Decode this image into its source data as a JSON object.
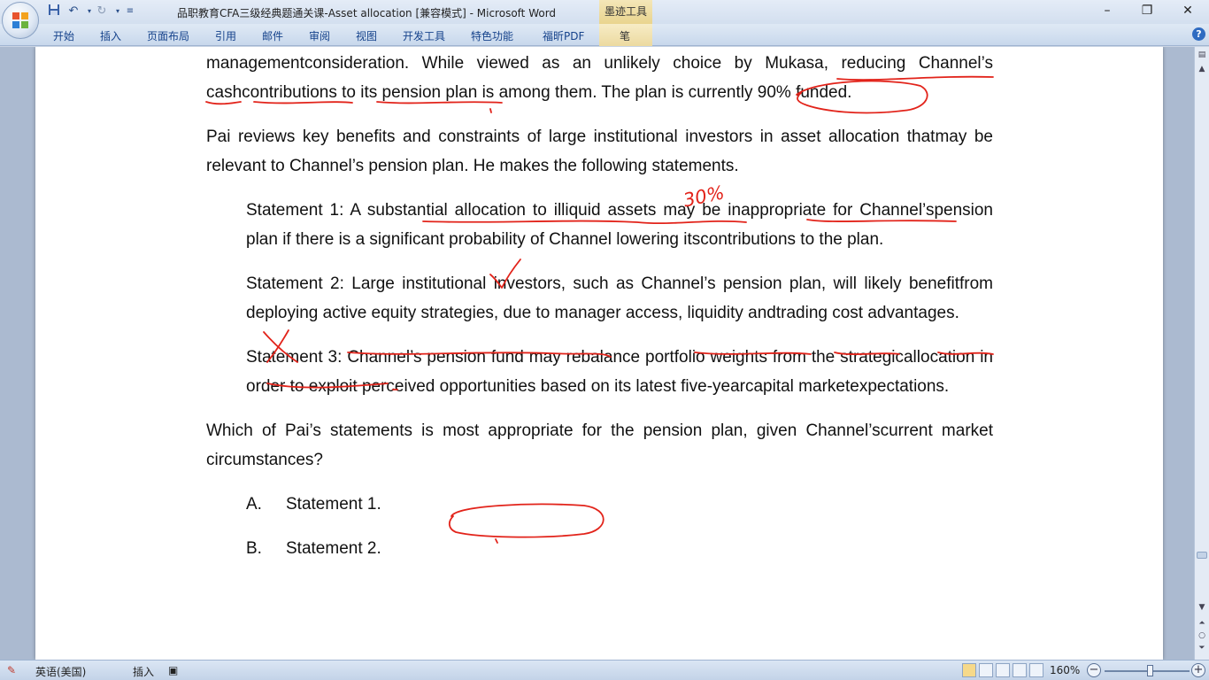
{
  "window": {
    "title": "品职教育CFA三级经典题通关课-Asset allocation [兼容模式] - Microsoft Word",
    "context_tab_title": "墨迹工具"
  },
  "ribbon": {
    "tabs": [
      "开始",
      "插入",
      "页面布局",
      "引用",
      "邮件",
      "审阅",
      "视图",
      "开发工具",
      "特色功能",
      "福昕PDF"
    ],
    "context_tab": "笔"
  },
  "document": {
    "intro_line1": "managementconsideration. While viewed as an unlikely choice by Mukasa, reducing Channel’s",
    "intro_line2": "cashcontributions to its pension plan is among them. The plan is currently 90% funded.",
    "para2": "Pai reviews key benefits and constraints of large institutional investors in asset allocation thatmay be relevant to Channel’s pension plan. He makes the following statements.",
    "statement1": "Statement 1: A substantial allocation to illiquid assets may be inappropriate for Channel’spension plan if there is a significant probability of Channel lowering itscontributions to the plan.",
    "statement2": "Statement 2: Large institutional investors, such as Channel’s pension plan, will likely benefitfrom deploying active equity strategies, due to manager access, liquidity andtrading cost advantages.",
    "statement3": "Statement 3: Channel’s pension fund may rebalance portfolio weights from the strategicallocation in order to exploit perceived opportunities based on its latest five-yearcapital marketexpectations.",
    "question": "Which of Pai’s statements is most appropriate for the pension plan, given Channel’scurrent market circumstances?",
    "options": [
      {
        "label": "A.",
        "text": "Statement 1."
      },
      {
        "label": "B.",
        "text": "Statement 2."
      }
    ],
    "ink_note": "30%"
  },
  "statusbar": {
    "language": "英语(美国)",
    "mode": "插入",
    "zoom": "160%"
  },
  "icons": {
    "office": "office-logo-icon",
    "save": "save-icon",
    "undo": "undo-icon",
    "redo": "redo-icon",
    "help": "help-icon"
  },
  "colors": {
    "ink": "#e2231a",
    "ribbon_text": "#15428b"
  }
}
